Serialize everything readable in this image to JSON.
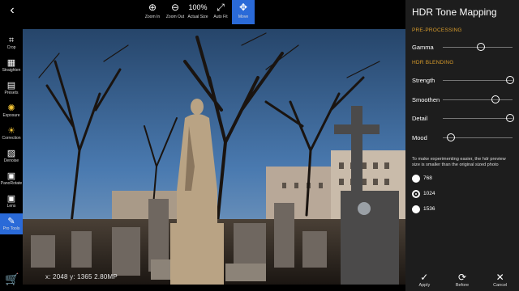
{
  "topbar": {
    "back_icon": "back-arrow-icon",
    "tools": [
      {
        "label": "Zoom In",
        "icon": "zoom-in-icon",
        "glyph": "⊕"
      },
      {
        "label": "Zoom Out",
        "icon": "zoom-out-icon",
        "glyph": "⊖"
      },
      {
        "label": "Actual Size",
        "icon": "actual-size-icon",
        "glyph": "100%"
      },
      {
        "label": "Auto Fit",
        "icon": "auto-fit-icon",
        "glyph": "⤢"
      },
      {
        "label": "Move",
        "icon": "move-icon",
        "glyph": "✥"
      }
    ]
  },
  "sidebar": {
    "items": [
      {
        "label": "Crop",
        "glyph": "⌗"
      },
      {
        "label": "Straighten",
        "glyph": "▦"
      },
      {
        "label": "Presets",
        "glyph": "▤"
      },
      {
        "label": "Exposure",
        "glyph": "✺"
      },
      {
        "label": "Correction",
        "glyph": "☀"
      },
      {
        "label": "Denoise",
        "glyph": "▨"
      },
      {
        "label": "PanoRotate",
        "glyph": "▣"
      },
      {
        "label": "Lens",
        "glyph": "▣"
      },
      {
        "label": "Pro Tools",
        "glyph": "✎"
      }
    ],
    "cart_icon": "cart-icon"
  },
  "image": {
    "info": "x: 2048 y: 1365  2.80MP"
  },
  "panel": {
    "title": "HDR Tone Mapping",
    "preprocessing": "PRE-PROCESSING",
    "gamma_label": "Gamma",
    "hdr_blending": "HDR BLENDING",
    "sliders": [
      {
        "label": "Strength",
        "value": 0.97
      },
      {
        "label": "Smoothen",
        "value": 0.75
      },
      {
        "label": "Detail",
        "value": 0.97
      },
      {
        "label": "Mood",
        "value": 0.12
      }
    ],
    "gamma_value": 0.55,
    "note": "To make experimenting easier, the hdr preview size is smaller than the original sized photo",
    "preview_sizes": [
      {
        "label": "768",
        "selected": false
      },
      {
        "label": "1024",
        "selected": true
      },
      {
        "label": "1536",
        "selected": false
      }
    ]
  },
  "actions": [
    {
      "label": "Apply",
      "glyph": "✓"
    },
    {
      "label": "Before",
      "glyph": "⟳"
    },
    {
      "label": "Cancel",
      "glyph": "✕"
    }
  ]
}
